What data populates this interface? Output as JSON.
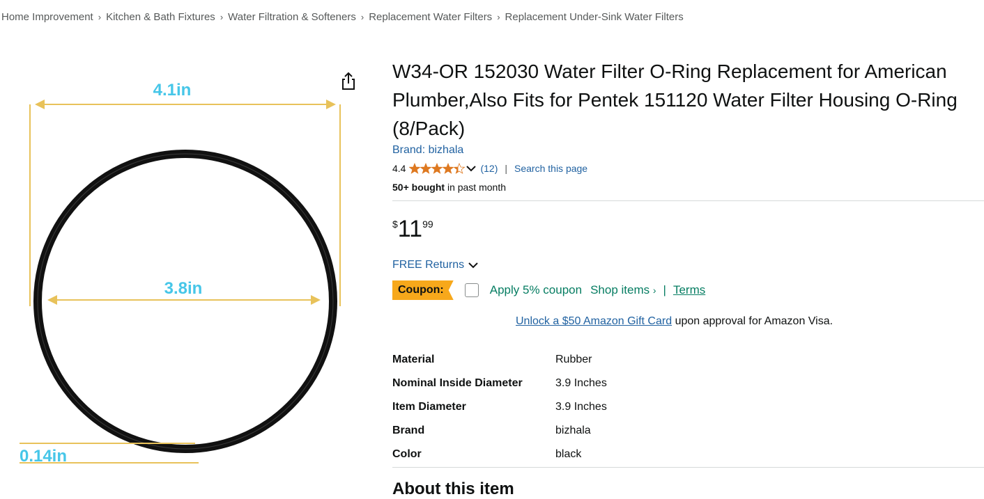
{
  "breadcrumb": [
    "Home Improvement",
    "Kitchen & Bath Fixtures",
    "Water Filtration & Softeners",
    "Replacement Water Filters",
    "Replacement Under-Sink Water Filters"
  ],
  "breadcrumb_separator": "›",
  "image": {
    "label_outer": "4.1in",
    "label_inner": "3.8in",
    "label_thickness": "0.14in"
  },
  "product": {
    "title": "W34-OR 152030 Water Filter O-Ring Replacement for American Plumber,Also Fits for Pentek 151120 Water Filter Housing O-Ring (8/Pack)",
    "brand": "Brand: bizhala",
    "rating_value": "4.4",
    "rating_stars": 4.4,
    "review_count": "(12)",
    "search_page": "Search this page",
    "bought_bold": "50+ bought",
    "bought_rest": "in past month",
    "price_symbol": "$",
    "price_whole": "11",
    "price_fraction": "99",
    "free_returns": "FREE Returns",
    "coupon_label": "Coupon:",
    "apply_coupon": "Apply 5% coupon",
    "shop_items": "Shop items",
    "shop_arrow": "›",
    "coupon_sep": "|",
    "terms": "Terms",
    "unlock_link": "Unlock a $50 Amazon Gift Card",
    "unlock_rest": "upon approval for Amazon Visa.",
    "about_heading": "About this item"
  },
  "specs": [
    {
      "key": "Material",
      "value": "Rubber"
    },
    {
      "key": "Nominal Inside Diameter",
      "value": "3.9 Inches"
    },
    {
      "key": "Item Diameter",
      "value": "3.9 Inches"
    },
    {
      "key": "Brand",
      "value": "bizhala"
    },
    {
      "key": "Color",
      "value": "black"
    }
  ],
  "colors": {
    "link": "#2162a1",
    "star": "#de7921",
    "coupon_badge": "#f7a81b",
    "coupon_text": "#067d62",
    "dimension_line": "#e8c25a",
    "dimension_text": "#46c6e8"
  }
}
